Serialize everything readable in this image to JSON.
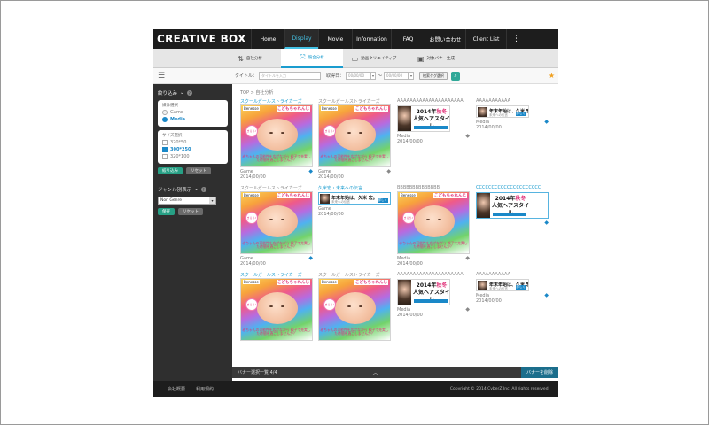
{
  "app": {
    "logo": "CREATIVE BOX"
  },
  "nav": {
    "items": [
      "Home",
      "Display",
      "Movie",
      "Information",
      "FAQ",
      "お問い合わせ",
      "Client List"
    ],
    "active": "Display",
    "more": "⋮"
  },
  "subnav": {
    "items": [
      {
        "label": "自社分析",
        "icon": "chart-icon"
      },
      {
        "label": "競合分析",
        "icon": "compare-icon"
      },
      {
        "label": "動画クリエイティブ",
        "icon": "video-icon"
      },
      {
        "label": "対象バナー生成",
        "icon": "banner-icon"
      }
    ],
    "active": "競合分析"
  },
  "filterbar": {
    "title_label": "タイトル：",
    "title_placeholder": "タイトルを入力",
    "date_label": "取得日：",
    "date_from": "00/00/00",
    "date_to": "00/00/00",
    "tag_button": "検索タグ選択"
  },
  "sidebar": {
    "filter_heading": "絞り込み",
    "media_box_title": "媒体選択",
    "media_options": [
      "Game",
      "Media"
    ],
    "media_selected": "Media",
    "size_box_title": "サイズ選択",
    "size_options": [
      "320*50",
      "300*250",
      "320*100"
    ],
    "size_selected": "300*250",
    "apply": "絞り込み",
    "reset": "リセット",
    "genre_heading": "ジャンル別表示",
    "genre_value": "Non Genre",
    "save": "保存",
    "reset2": "リセット"
  },
  "main": {
    "breadcrumb": "TOP > 自社分析",
    "cards": [
      {
        "title": "スクールガールストライカーズ",
        "media": "Game",
        "date": "2014/00/00",
        "kind": "rainbow",
        "hl": true,
        "tag": "blue"
      },
      {
        "title": "スクールガールストライカーズ",
        "media": "Game",
        "date": "2014/00/00",
        "kind": "rainbow",
        "hl": false,
        "tag": "gray"
      },
      {
        "title": "AAAAAAAAAAAAAAAAAAAAA",
        "media": "Media",
        "date": "2014/00/00",
        "kind": "mid",
        "hl": false,
        "tag": "gray"
      },
      {
        "title": "AAAAAAAAAAA",
        "media": "Media",
        "date": "2014/00/00",
        "kind": "strip",
        "hl": false,
        "tag": "blue"
      },
      {
        "title": "スクールガールストライカーズ",
        "media": "Game",
        "date": "2014/00/00",
        "kind": "rainbow",
        "hl": false,
        "tag": "blue"
      },
      {
        "title": "久米宏・未来への伝言",
        "media": "Game",
        "date": "2014/00/00",
        "kind": "strip",
        "hl": true,
        "tag": "none"
      },
      {
        "title": "BBBBBBBBBBBBBB",
        "media": "Media",
        "date": "2014/00/00",
        "kind": "rainbow",
        "hl": false,
        "tag": "gray"
      },
      {
        "title": "CCCCCCCCCCCCCCCCCCCCC",
        "media": "",
        "date": "",
        "kind": "mid",
        "hl": true,
        "tag": "blue"
      },
      {
        "title": "スクールガールストライカーズ",
        "media": "",
        "date": "",
        "kind": "rainbow",
        "hl": true,
        "tag": "none"
      },
      {
        "title": "スクールガールストライカーズ",
        "media": "",
        "date": "",
        "kind": "rainbow",
        "hl": false,
        "tag": "none"
      },
      {
        "title": "AAAAAAAAAAAAAAAAAAAAA",
        "media": "Media",
        "date": "2014/00/00",
        "kind": "mid",
        "hl": false,
        "tag": "gray"
      },
      {
        "title": "AAAAAAAAAAA",
        "media": "Media",
        "date": "2014/00/00",
        "kind": "strip",
        "hl": false,
        "tag": "blue"
      }
    ],
    "creative_text": {
      "logo": "Benesse",
      "brand": "こどもちゃれんじ",
      "copy": "赤ちゃんの可能性を広げながら\n親子で充実した時間を過ごしませんか？",
      "badge": "きらり♪",
      "strip_headline": "年末年始は、久米 宏。",
      "strip_sub": "未来への伝言",
      "strip_cta": "詳しく",
      "mid_line1_a": "2014年",
      "mid_line1_b": "秋冬",
      "mid_line2": "人気ヘアスタイル"
    }
  },
  "bottombar": {
    "label": "バナー選択一覧  4/4",
    "chevron": "︿",
    "button": "バナーを削除"
  },
  "footer": {
    "links": [
      "会社概要",
      "利用規約"
    ],
    "copyright": "Copyright © 2014 CyberZ,Inc. All rights reserved."
  },
  "colors": {
    "accent": "#1a9ccf",
    "green": "#27a085",
    "dark": "#1d1d1d"
  }
}
